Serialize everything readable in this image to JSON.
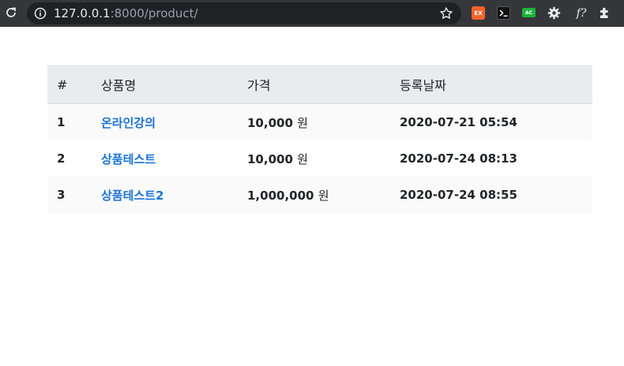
{
  "browser": {
    "url_host": "127.0.0.1",
    "url_rest": ":8000/product/",
    "extensions": {
      "ex_label": "EX",
      "ac_label": "AC",
      "fx_label": "f?"
    }
  },
  "table": {
    "headers": {
      "num": "#",
      "name": "상품명",
      "price": "가격",
      "date": "등록날짜"
    },
    "rows": [
      {
        "num": "1",
        "name": "온라인강의",
        "price": "10,000",
        "unit": "원",
        "date": "2020-07-21 05:54"
      },
      {
        "num": "2",
        "name": "상품테스트",
        "price": "10,000",
        "unit": "원",
        "date": "2020-07-24 08:13"
      },
      {
        "num": "3",
        "name": "상품테스트2",
        "price": "1,000,000",
        "unit": "원",
        "date": "2020-07-24 08:55"
      }
    ]
  },
  "colors": {
    "toolbar_bg": "#35363a",
    "omnibox_bg": "#202124",
    "header_bg": "#e9ecef",
    "link": "#1a73d6"
  }
}
